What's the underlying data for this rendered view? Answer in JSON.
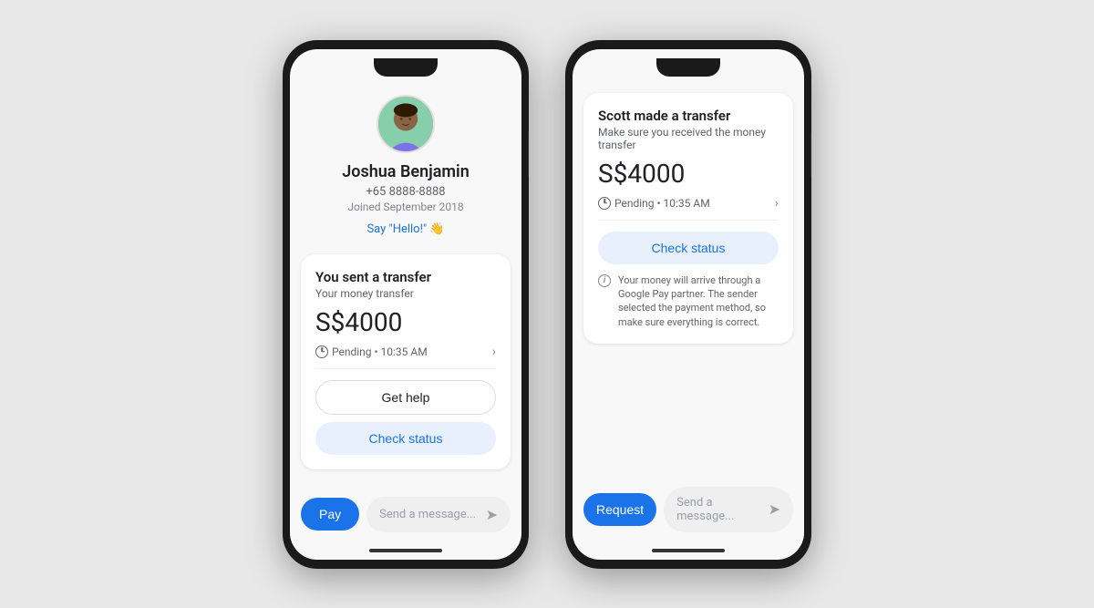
{
  "page": {
    "bg_color": "#e8e8e8"
  },
  "phone1": {
    "profile": {
      "name": "Joshua Benjamin",
      "phone": "+65 8888-8888",
      "joined": "Joined September 2018",
      "say_hello": "Say \"Hello!\" 👋"
    },
    "card": {
      "title": "You sent a transfer",
      "subtitle": "Your money transfer",
      "amount": "S$4000",
      "status": "Pending • 10:35 AM",
      "get_help_label": "Get help",
      "check_status_label": "Check status"
    },
    "bottom_bar": {
      "pay_label": "Pay",
      "message_placeholder": "Send a message..."
    }
  },
  "phone2": {
    "card": {
      "title": "Scott made a transfer",
      "subtitle": "Make sure you received the money transfer",
      "amount": "S$4000",
      "status": "Pending • 10:35 AM",
      "check_status_label": "Check status",
      "info_text": "Your money will arrive through a Google Pay partner. The sender selected the payment method, so make sure everything is correct."
    },
    "bottom_bar": {
      "request_label": "Request",
      "message_placeholder": "Send a message..."
    }
  }
}
